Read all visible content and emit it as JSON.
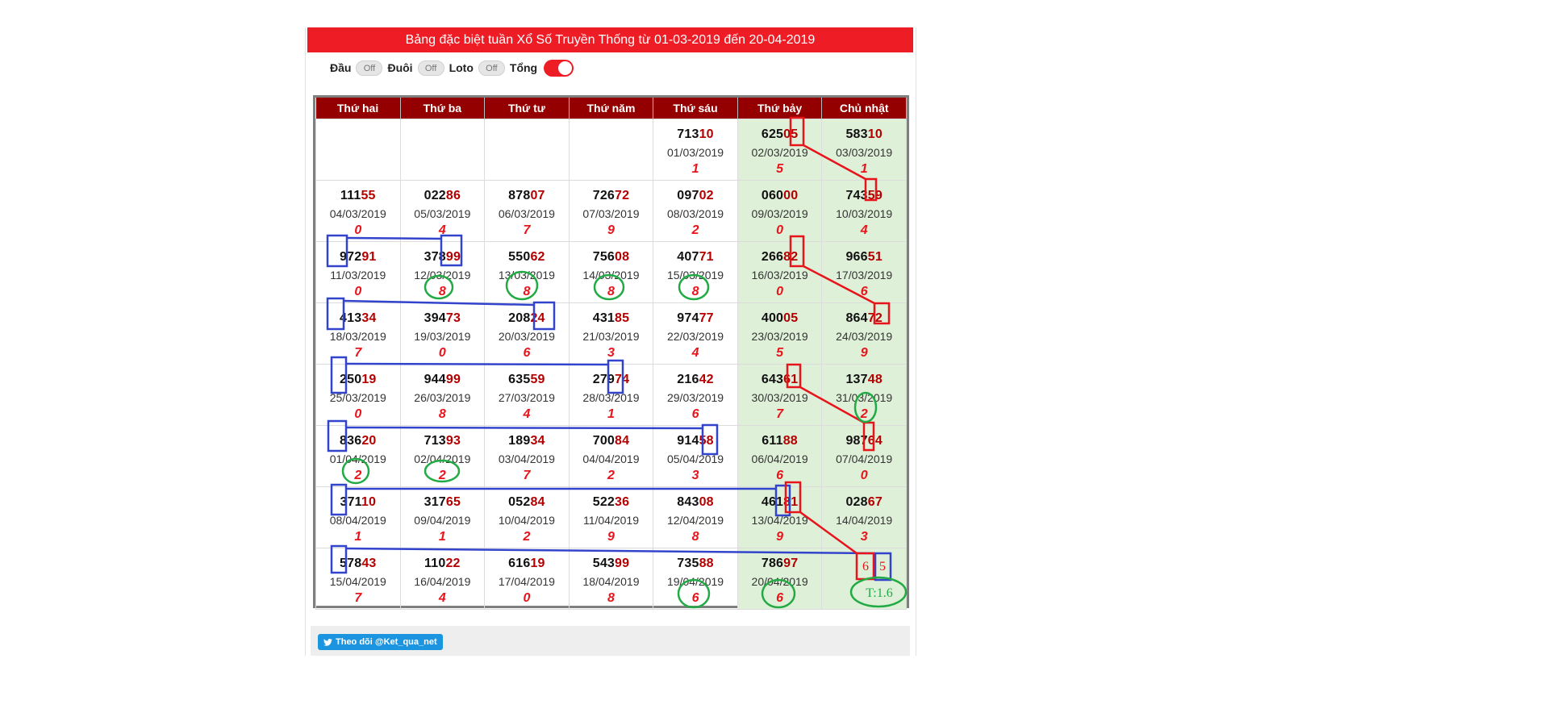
{
  "title": "Bảng đặc biệt tuần Xổ Số Truyền Thống từ 01-03-2019 đến 20-04-2019",
  "toggles": [
    {
      "label": "Đầu",
      "state": "Off"
    },
    {
      "label": "Đuôi",
      "state": "Off"
    },
    {
      "label": "Loto",
      "state": "Off"
    },
    {
      "label": "Tổng",
      "state": "On"
    }
  ],
  "headers": [
    "Thứ hai",
    "Thứ ba",
    "Thứ tư",
    "Thứ năm",
    "Thứ sáu",
    "Thứ bảy",
    "Chủ nhật"
  ],
  "rows": [
    [
      null,
      null,
      null,
      null,
      {
        "head": "713",
        "tail": "10",
        "date": "01/03/2019",
        "sum": "1"
      },
      {
        "head": "625",
        "tail": "05",
        "date": "02/03/2019",
        "sum": "5"
      },
      {
        "head": "583",
        "tail": "10",
        "date": "03/03/2019",
        "sum": "1"
      }
    ],
    [
      {
        "head": "111",
        "tail": "55",
        "date": "04/03/2019",
        "sum": "0"
      },
      {
        "head": "022",
        "tail": "86",
        "date": "05/03/2019",
        "sum": "4"
      },
      {
        "head": "878",
        "tail": "07",
        "date": "06/03/2019",
        "sum": "7"
      },
      {
        "head": "726",
        "tail": "72",
        "date": "07/03/2019",
        "sum": "9"
      },
      {
        "head": "097",
        "tail": "02",
        "date": "08/03/2019",
        "sum": "2"
      },
      {
        "head": "060",
        "tail": "00",
        "date": "09/03/2019",
        "sum": "0"
      },
      {
        "head": "743",
        "tail": "59",
        "date": "10/03/2019",
        "sum": "4"
      }
    ],
    [
      {
        "head": "972",
        "tail": "91",
        "date": "11/03/2019",
        "sum": "0"
      },
      {
        "head": "378",
        "tail": "99",
        "date": "12/03/2019",
        "sum": "8"
      },
      {
        "head": "550",
        "tail": "62",
        "date": "13/03/2019",
        "sum": "8"
      },
      {
        "head": "756",
        "tail": "08",
        "date": "14/03/2019",
        "sum": "8"
      },
      {
        "head": "407",
        "tail": "71",
        "date": "15/03/2019",
        "sum": "8"
      },
      {
        "head": "266",
        "tail": "82",
        "date": "16/03/2019",
        "sum": "0"
      },
      {
        "head": "966",
        "tail": "51",
        "date": "17/03/2019",
        "sum": "6"
      }
    ],
    [
      {
        "head": "413",
        "tail": "34",
        "date": "18/03/2019",
        "sum": "7"
      },
      {
        "head": "394",
        "tail": "73",
        "date": "19/03/2019",
        "sum": "0"
      },
      {
        "head": "208",
        "tail": "24",
        "date": "20/03/2019",
        "sum": "6"
      },
      {
        "head": "431",
        "tail": "85",
        "date": "21/03/2019",
        "sum": "3"
      },
      {
        "head": "974",
        "tail": "77",
        "date": "22/03/2019",
        "sum": "4"
      },
      {
        "head": "400",
        "tail": "05",
        "date": "23/03/2019",
        "sum": "5"
      },
      {
        "head": "864",
        "tail": "72",
        "date": "24/03/2019",
        "sum": "9"
      }
    ],
    [
      {
        "head": "250",
        "tail": "19",
        "date": "25/03/2019",
        "sum": "0"
      },
      {
        "head": "944",
        "tail": "99",
        "date": "26/03/2019",
        "sum": "8"
      },
      {
        "head": "635",
        "tail": "59",
        "date": "27/03/2019",
        "sum": "4"
      },
      {
        "head": "279",
        "tail": "74",
        "date": "28/03/2019",
        "sum": "1"
      },
      {
        "head": "216",
        "tail": "42",
        "date": "29/03/2019",
        "sum": "6"
      },
      {
        "head": "643",
        "tail": "61",
        "date": "30/03/2019",
        "sum": "7"
      },
      {
        "head": "137",
        "tail": "48",
        "date": "31/03/2019",
        "sum": "2"
      }
    ],
    [
      {
        "head": "836",
        "tail": "20",
        "date": "01/04/2019",
        "sum": "2"
      },
      {
        "head": "713",
        "tail": "93",
        "date": "02/04/2019",
        "sum": "2"
      },
      {
        "head": "189",
        "tail": "34",
        "date": "03/04/2019",
        "sum": "7"
      },
      {
        "head": "700",
        "tail": "84",
        "date": "04/04/2019",
        "sum": "2"
      },
      {
        "head": "914",
        "tail": "58",
        "date": "05/04/2019",
        "sum": "3"
      },
      {
        "head": "611",
        "tail": "88",
        "date": "06/04/2019",
        "sum": "6"
      },
      {
        "head": "987",
        "tail": "64",
        "date": "07/04/2019",
        "sum": "0"
      }
    ],
    [
      {
        "head": "371",
        "tail": "10",
        "date": "08/04/2019",
        "sum": "1"
      },
      {
        "head": "317",
        "tail": "65",
        "date": "09/04/2019",
        "sum": "1"
      },
      {
        "head": "052",
        "tail": "84",
        "date": "10/04/2019",
        "sum": "2"
      },
      {
        "head": "522",
        "tail": "36",
        "date": "11/04/2019",
        "sum": "9"
      },
      {
        "head": "843",
        "tail": "08",
        "date": "12/04/2019",
        "sum": "8"
      },
      {
        "head": "461",
        "tail": "81",
        "date": "13/04/2019",
        "sum": "9"
      },
      {
        "head": "028",
        "tail": "67",
        "date": "14/04/2019",
        "sum": "3"
      }
    ],
    [
      {
        "head": "578",
        "tail": "43",
        "date": "15/04/2019",
        "sum": "7"
      },
      {
        "head": "110",
        "tail": "22",
        "date": "16/04/2019",
        "sum": "4"
      },
      {
        "head": "616",
        "tail": "19",
        "date": "17/04/2019",
        "sum": "0"
      },
      {
        "head": "543",
        "tail": "99",
        "date": "18/04/2019",
        "sum": "8"
      },
      {
        "head": "735",
        "tail": "88",
        "date": "19/04/2019",
        "sum": "6"
      },
      {
        "head": "786",
        "tail": "97",
        "date": "20/04/2019",
        "sum": "6"
      },
      null
    ]
  ],
  "annotations": {
    "prediction_red": "6",
    "prediction_blue": "5",
    "note": "T:1.6",
    "red_color": "#e8141b",
    "blue_color": "#3344cc",
    "green_color": "#22aa44"
  },
  "twitter_button": "Theo dõi @Ket_qua_net",
  "colors": {
    "accent": "#ee1c25",
    "header": "#940000",
    "weekend": "#dff0d8"
  }
}
